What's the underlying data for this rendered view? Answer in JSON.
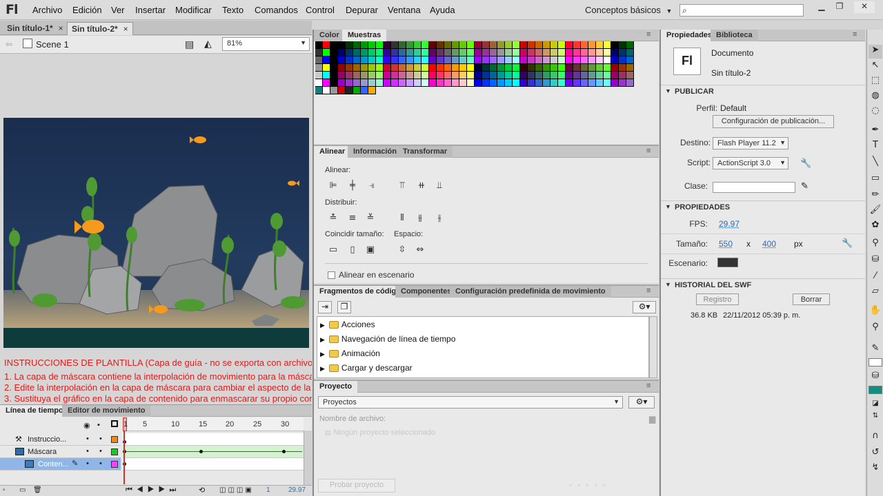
{
  "app": {
    "logo": "Fl"
  },
  "menu": [
    "Archivo",
    "Edición",
    "Ver",
    "Insertar",
    "Modificar",
    "Texto",
    "Comandos",
    "Control",
    "Depurar",
    "Ventana",
    "Ayuda"
  ],
  "workspace": "Conceptos básicos",
  "doc_tabs": [
    {
      "label": "Sin título-1*",
      "close": "×"
    },
    {
      "label": "Sin título-2*",
      "close": "×"
    }
  ],
  "scene": {
    "label": "Scene 1",
    "zoom": "81%"
  },
  "guide_text": [
    "INSTRUCCIONES DE PLANTILLA (Capa de guía - no se exporta con archivo",
    "1. La capa de máscara contiene la interpolación de movimiento para la másca",
    "2. Edite la interpolación en la capa de máscara para cambiar el aspecto de la",
    "3. Sustituya el gráfico en la capa de contenido para enmascarar su propio cor"
  ],
  "timeline": {
    "tabs": [
      "Línea de tiempo",
      "Editor de movimiento"
    ],
    "ruler": [
      "1",
      "5",
      "10",
      "15",
      "20",
      "25",
      "30"
    ],
    "layers": [
      "Instruccio...",
      "Máscara",
      "Conten..."
    ],
    "frame_num": "1",
    "fps": "29.97"
  },
  "swatch_tabs": [
    "Color",
    "Muestras"
  ],
  "align": {
    "tabs": [
      "Alinear",
      "Información",
      "Transformar"
    ],
    "alinear": "Alinear:",
    "distribuir": "Distribuir:",
    "coincidir": "Coincidir tamaño:",
    "espacio": "Espacio:",
    "stage_check": "Alinear en escenario"
  },
  "snippets": {
    "tabs": [
      "Fragmentos de código",
      "Componentes",
      "Configuración predefinida de movimiento"
    ],
    "items": [
      "Acciones",
      "Navegación de línea de tiempo",
      "Animación",
      "Cargar y descargar"
    ]
  },
  "project": {
    "tab": "Proyecto",
    "select": "Proyectos",
    "file_label": "Nombre de archivo:",
    "empty": "Ningún proyecto seleccionado",
    "test_btn": "Probar proyecto"
  },
  "properties": {
    "tabs": [
      "Propiedades",
      "Biblioteca"
    ],
    "doc_type": "Documento",
    "doc_name": "Sin título-2",
    "fl_icon": "Fl",
    "publish_hdr": "PUBLICAR",
    "perfil_label": "Perfil:",
    "perfil_val": "Default",
    "pub_config_btn": "Configuración de publicación...",
    "destino_label": "Destino:",
    "destino_val": "Flash Player 11.2",
    "script_label": "Script:",
    "script_val": "ActionScript 3.0",
    "clase_label": "Clase:",
    "props_hdr": "PROPIEDADES",
    "fps_label": "FPS:",
    "fps_val": "29.97",
    "size_label": "Tamaño:",
    "width": "550",
    "x": "x",
    "height": "400",
    "unit": "px",
    "stage_label": "Escenario:",
    "stage_color": "#333333",
    "swf_hdr": "HISTORIAL DEL SWF",
    "registro_btn": "Registro",
    "borrar_btn": "Borrar",
    "swf_size": "36.8 KB",
    "swf_date": "22/11/2012 05:39 p. m."
  },
  "colors": {
    "accent": "#2d6ab3",
    "guide_red": "#e01b1b",
    "stage_bg": "#1b2f4e"
  }
}
